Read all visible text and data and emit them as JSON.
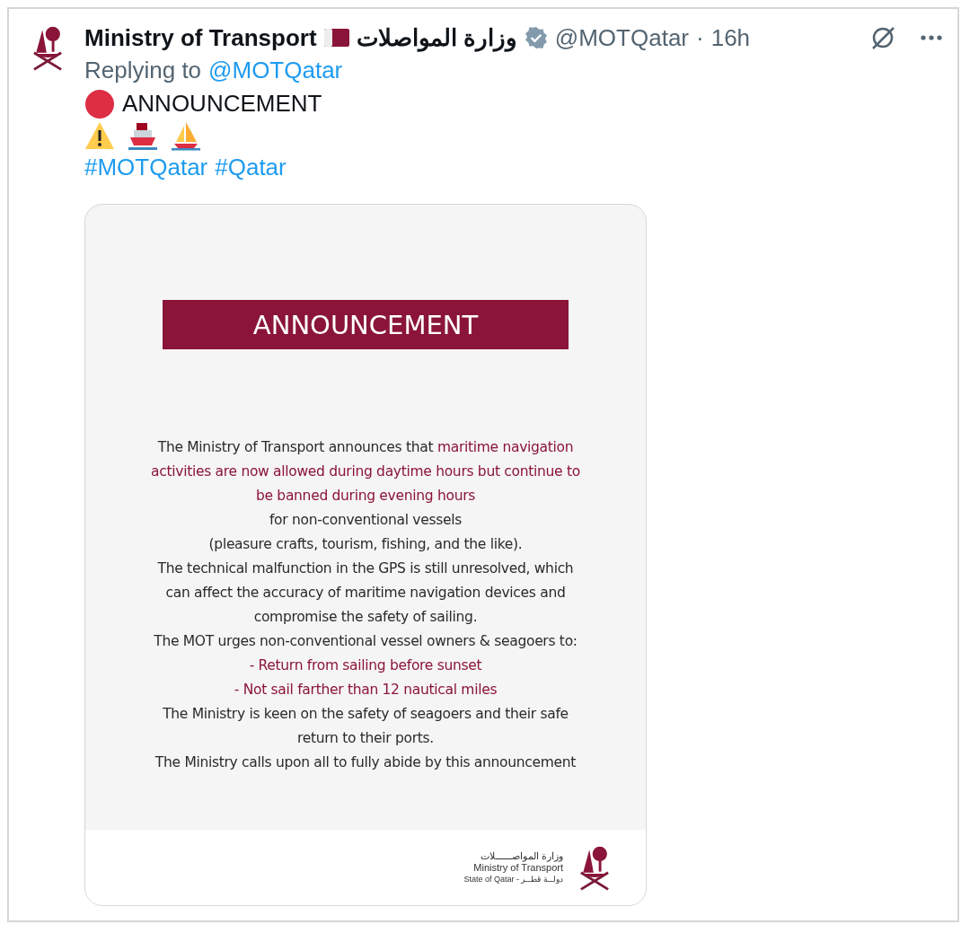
{
  "post": {
    "author": "Ministry of Transport",
    "author_arabic": "وزارة المواصلات",
    "handle": "@MOTQatar",
    "separator": "·",
    "time": "16h",
    "verified": true,
    "replying_prefix": "Replying to",
    "replying_to": "@MOTQatar",
    "heading": "ANNOUNCEMENT",
    "hashtags": [
      "#MOTQatar",
      "#Qatar"
    ]
  },
  "image": {
    "banner": "ANNOUNCEMENT",
    "lines": [
      {
        "segments": [
          {
            "text": "The Ministry of Transport announces that ",
            "highlighted": false
          },
          {
            "text": "maritime navigation",
            "highlighted": true
          }
        ]
      },
      {
        "segments": [
          {
            "text": "activities are now allowed during daytime hours but continue to",
            "highlighted": true
          }
        ]
      },
      {
        "segments": [
          {
            "text": "be banned during evening hours",
            "highlighted": true
          }
        ]
      },
      {
        "segments": [
          {
            "text": "for non-conventional vessels",
            "highlighted": false
          }
        ]
      },
      {
        "segments": [
          {
            "text": "(pleasure crafts, tourism, fishing, and the like).",
            "highlighted": false
          }
        ]
      },
      {
        "segments": [
          {
            "text": "The technical malfunction in the GPS is still unresolved, which",
            "highlighted": false
          }
        ]
      },
      {
        "segments": [
          {
            "text": "can affect the accuracy of maritime navigation devices and",
            "highlighted": false
          }
        ]
      },
      {
        "segments": [
          {
            "text": "compromise the safety of sailing.",
            "highlighted": false
          }
        ]
      },
      {
        "segments": [
          {
            "text": "The MOT urges non-conventional vessel owners & seagoers to:",
            "highlighted": false
          }
        ]
      },
      {
        "segments": [
          {
            "text": "- Return from sailing before sunset",
            "highlighted": true
          }
        ]
      },
      {
        "segments": [
          {
            "text": "- Not sail farther than 12 nautical miles",
            "highlighted": true
          }
        ]
      },
      {
        "segments": [
          {
            "text": "The Ministry is keen on the safety of seagoers and their safe",
            "highlighted": false
          }
        ]
      },
      {
        "segments": [
          {
            "text": "return to their ports.",
            "highlighted": false
          }
        ]
      },
      {
        "segments": [
          {
            "text": "The Ministry calls upon all to fully abide by this announcement",
            "highlighted": false
          }
        ]
      }
    ],
    "logo": {
      "arabic": "وزارة المواصــــــلات",
      "english": "Ministry of Transport",
      "state": "State of Qatar - دولــة قطــر"
    }
  }
}
